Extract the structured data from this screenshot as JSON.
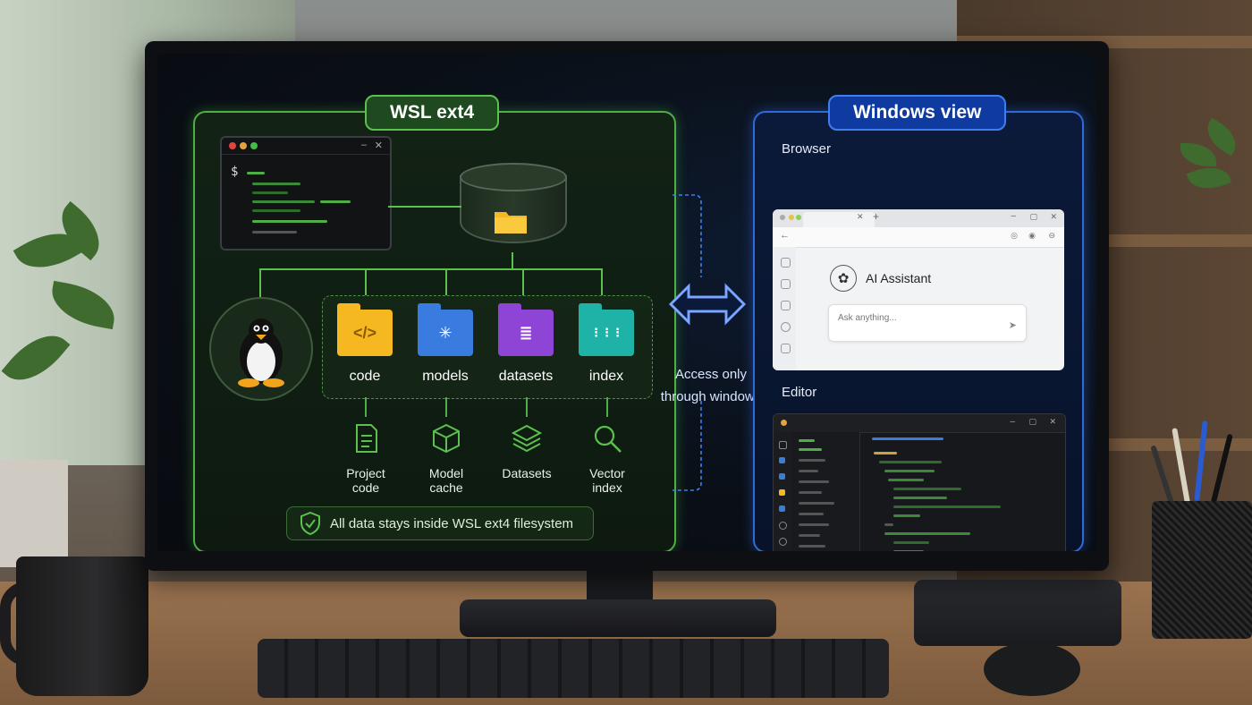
{
  "wsl_panel": {
    "title": "WSL ext4",
    "terminal_prompt": "$",
    "folders": [
      {
        "label": "code",
        "glyph": "</>",
        "color": "#f5b821",
        "icon": "code-folder-icon"
      },
      {
        "label": "models",
        "glyph": "✳",
        "color": "#3a7be0",
        "icon": "network-folder-icon"
      },
      {
        "label": "datasets",
        "glyph": "≣",
        "color": "#8e45d6",
        "icon": "database-folder-icon"
      },
      {
        "label": "index",
        "glyph": "⋮⋮⋮",
        "color": "#1fb3a8",
        "icon": "grid-folder-icon"
      }
    ],
    "sub_items": [
      {
        "line1": "Project",
        "line2": "code",
        "icon": "document-icon"
      },
      {
        "line1": "Model",
        "line2": "cache",
        "icon": "cube-icon"
      },
      {
        "line1": "Datasets",
        "line2": "",
        "icon": "layers-icon"
      },
      {
        "line1": "Vector",
        "line2": "index",
        "icon": "magnifier-icon"
      }
    ],
    "footer": "All data stays inside WSL ext4 filesystem"
  },
  "connector": {
    "line1": "Access only",
    "line2": "through windows"
  },
  "windows_panel": {
    "title": "Windows view",
    "browser_label": "Browser",
    "assistant_title": "AI Assistant",
    "ask_placeholder": "Ask anything...",
    "editor_label": "Editor"
  },
  "colors": {
    "wsl_green": "#4fae45",
    "windows_blue": "#2e6bd8",
    "arrow_blue": "#5b8cff"
  }
}
